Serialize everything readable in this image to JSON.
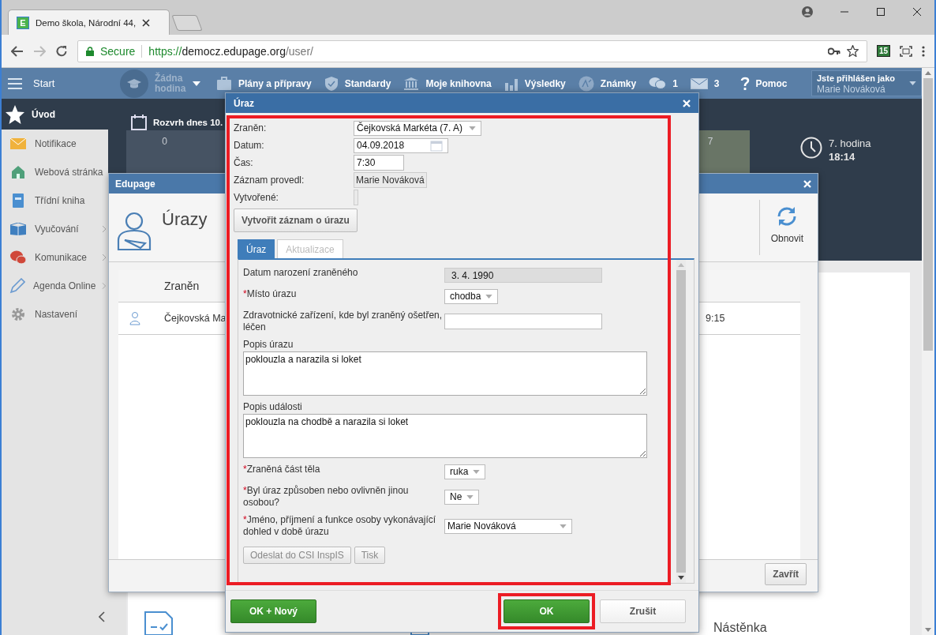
{
  "browser": {
    "favicon_letter": "E",
    "tab_title": "Demo škola, Národní 44,",
    "security_label": "Secure",
    "url_scheme": "https://",
    "url_host": "democz.edupage.org",
    "url_path": "/user/",
    "extension_badge": "15"
  },
  "topnav": {
    "start": "Start",
    "lesson": "Žádna hodina",
    "items": [
      "Plány a přípravy",
      "Standardy",
      "Moje knihovna",
      "Výsledky",
      "Známky"
    ],
    "chat_count": "1",
    "mail_count": "3",
    "help": "Pomoc",
    "user_caption": "Jste přihlášen jako",
    "user_name": "Marie Nováková"
  },
  "sidebar": {
    "items": [
      {
        "label": "Úvod",
        "selected": true,
        "has_submenu": false
      },
      {
        "label": "Notifikace",
        "selected": false,
        "has_submenu": false
      },
      {
        "label": "Webová stránka",
        "selected": false,
        "has_submenu": false
      },
      {
        "label": "Třídní kniha",
        "selected": false,
        "has_submenu": false
      },
      {
        "label": "Vyučování",
        "selected": false,
        "has_submenu": true
      },
      {
        "label": "Komunikace",
        "selected": false,
        "has_submenu": true
      },
      {
        "label": "Agenda Online",
        "selected": false,
        "has_submenu": true
      },
      {
        "label": "Nastavení",
        "selected": false,
        "has_submenu": false
      }
    ]
  },
  "schedule": {
    "title": "Rozvrh dnes 10.",
    "cells": [
      {
        "label": "0",
        "current": false
      },
      {
        "label": "7",
        "current": true
      }
    ],
    "period": "7. hodina",
    "time": "18:14"
  },
  "edupage_window": {
    "title": "Edupage",
    "module_title": "Úrazy",
    "refresh_label": "Obnovit",
    "column_1": "Zraněn",
    "rows": [
      {
        "name": "Čejkovská Ma",
        "time": "9:15"
      }
    ],
    "close_label": "Zavřít"
  },
  "dialog": {
    "title": "Úraz",
    "body_highlighted": true,
    "fields": [
      {
        "label": "Zraněn:",
        "kind": "select",
        "value": "Čejkovská Markéta (7. A)"
      },
      {
        "label": "Datum:",
        "kind": "date",
        "value": "04.09.2018"
      },
      {
        "label": "Čas:",
        "kind": "input",
        "value": "7:30"
      },
      {
        "label": "Záznam provedl:",
        "kind": "readonly",
        "value": "Marie Nováková"
      },
      {
        "label": "Vytvořené:",
        "kind": "empty"
      }
    ],
    "create_button": "Vytvořit záznam o úrazu",
    "tabs": [
      {
        "label": "Úraz",
        "selected": true
      },
      {
        "label": "Aktualizace",
        "selected": false
      }
    ],
    "form": [
      {
        "label": "Datum narození zraněného",
        "kind": "readonly",
        "value": "3. 4. 1990"
      },
      {
        "label": "Místo úrazu",
        "required_mark": "*",
        "kind": "select",
        "value": "chodba"
      },
      {
        "label": "Zdravotnické zařízení, kde byl zraněný ošetřen, léčen",
        "kind": "input"
      },
      {
        "label": "Popis úrazu",
        "kind": "textarea",
        "value": "poklouzla a narazila si loket"
      },
      {
        "label": "Popis události",
        "kind": "textarea",
        "value": "poklouzla na chodbě a narazila si loket"
      },
      {
        "label": "Zraněná část těla",
        "required_mark": "*",
        "kind": "select",
        "value": "ruka"
      },
      {
        "label": "Byl úraz způsoben nebo ovlivněn jinou osobou?",
        "required_mark": "*",
        "kind": "select",
        "value": "Ne"
      },
      {
        "label": "Jméno, příjmení a funkce osoby vykonávající dohled v době úrazu",
        "required_mark": "*",
        "kind": "wideselect",
        "value": "Marie Nováková"
      }
    ],
    "action_buttons": [
      {
        "label": "Odeslat do CSI InspIS",
        "disabled": true
      },
      {
        "label": "Tisk",
        "disabled": true
      }
    ],
    "footer_buttons": [
      {
        "label": "OK + Nový",
        "kind": "primary",
        "highlighted": false
      },
      {
        "label": "OK",
        "kind": "primary",
        "highlighted": true
      },
      {
        "label": "Zrušit",
        "kind": "secondary",
        "highlighted": false
      }
    ]
  },
  "bottom_tiles": [
    {
      "label": "Nástěnka"
    }
  ]
}
